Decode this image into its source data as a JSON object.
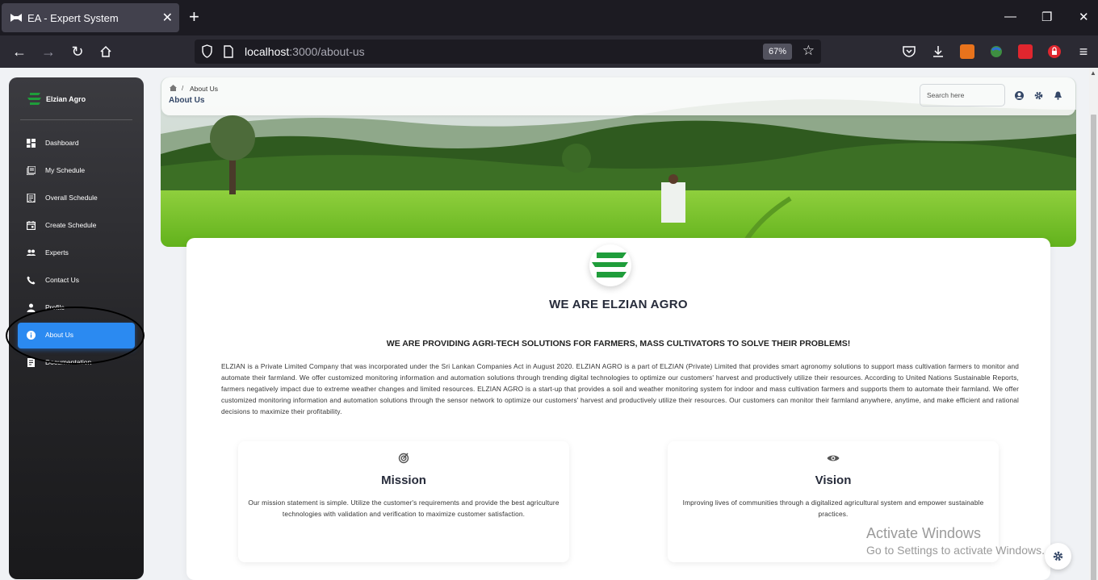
{
  "browser": {
    "tab_title": "EA - Expert System",
    "url_host": "localhost",
    "url_rest": ":3000/about-us",
    "zoom": "67%"
  },
  "sidebar": {
    "brand": "Elzian Agro",
    "items": [
      {
        "label": "Dashboard",
        "icon": "dashboard-icon",
        "active": false
      },
      {
        "label": "My Schedule",
        "icon": "schedule-icon",
        "active": false
      },
      {
        "label": "Overall Schedule",
        "icon": "receipt-icon",
        "active": false
      },
      {
        "label": "Create Schedule",
        "icon": "calendar-icon",
        "active": false
      },
      {
        "label": "Experts",
        "icon": "people-icon",
        "active": false
      },
      {
        "label": "Contact Us",
        "icon": "phone-icon",
        "active": false
      },
      {
        "label": "Profile",
        "icon": "person-icon",
        "active": false
      },
      {
        "label": "About Us",
        "icon": "info-icon",
        "active": true
      },
      {
        "label": "Documentation",
        "icon": "document-icon",
        "active": false
      }
    ]
  },
  "header": {
    "breadcrumb_current": "About Us",
    "title": "About Us",
    "search_placeholder": "Search here"
  },
  "about": {
    "company_title": "WE ARE ELZIAN AGRO",
    "tagline": "WE ARE PROVIDING AGRI-TECH SOLUTIONS FOR FARMERS, MASS CULTIVATORS TO SOLVE THEIR PROBLEMS!",
    "description": "ELZIAN is a Private Limited Company that was incorporated under the Sri Lankan Companies Act in August 2020. ELZIAN AGRO is a part of ELZIAN (Private) Limited that provides smart agronomy solutions to support mass cultivation farmers to monitor and automate their farmland. We offer customized monitoring information and automation solutions through trending digital technologies to optimize our customers' harvest and productively utilize their resources. According to United Nations Sustainable Reports, farmers negatively impact due to extreme weather changes and limited resources. ELZIAN AGRO is a start-up that provides a soil and weather monitoring system for indoor and mass cultivation farmers and supports them to automate their farmland. We offer customized monitoring information and automation solutions through the sensor network to optimize our customers' harvest and productively utilize their resources. Our customers can monitor their farmland anywhere, anytime, and make efficient and rational decisions to maximize their profitability.",
    "mission": {
      "title": "Mission",
      "text": "Our mission statement is simple. Utilize the customer's requirements and provide the best agriculture technologies with validation and verification to maximize customer satisfaction."
    },
    "vision": {
      "title": "Vision",
      "text": "Improving lives of communities through a digitalized agricultural system and empower sustainable practices."
    }
  },
  "watermark": {
    "line1": "Activate Windows",
    "line2": "Go to Settings to activate Windows."
  },
  "colors": {
    "active_item": "#2b8af1",
    "brand_green": "#1f9d3a",
    "sidebar_dark": "#252528"
  }
}
